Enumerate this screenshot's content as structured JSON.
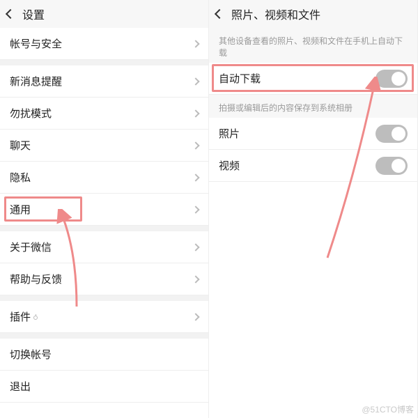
{
  "left": {
    "title": "设置",
    "items": [
      {
        "label": "帐号与安全"
      },
      {
        "label": "新消息提醒"
      },
      {
        "label": "勿扰模式"
      },
      {
        "label": "聊天"
      },
      {
        "label": "隐私"
      },
      {
        "label": "通用",
        "highlight": true
      },
      {
        "label": "关于微信"
      },
      {
        "label": "帮助与反馈"
      },
      {
        "label": "插件",
        "icon": "location"
      },
      {
        "label": "切换帐号"
      },
      {
        "label": "退出"
      }
    ]
  },
  "right": {
    "title": "照片、视频和文件",
    "hint1": "其他设备查看的照片、视频和文件在手机上自动下载",
    "hint2": "拍摄或编辑后的内容保存到系统相册",
    "toggles": [
      {
        "label": "自动下载",
        "highlight": true
      },
      {
        "label": "照片"
      },
      {
        "label": "视频"
      }
    ]
  },
  "watermark": "@51CTO博客"
}
